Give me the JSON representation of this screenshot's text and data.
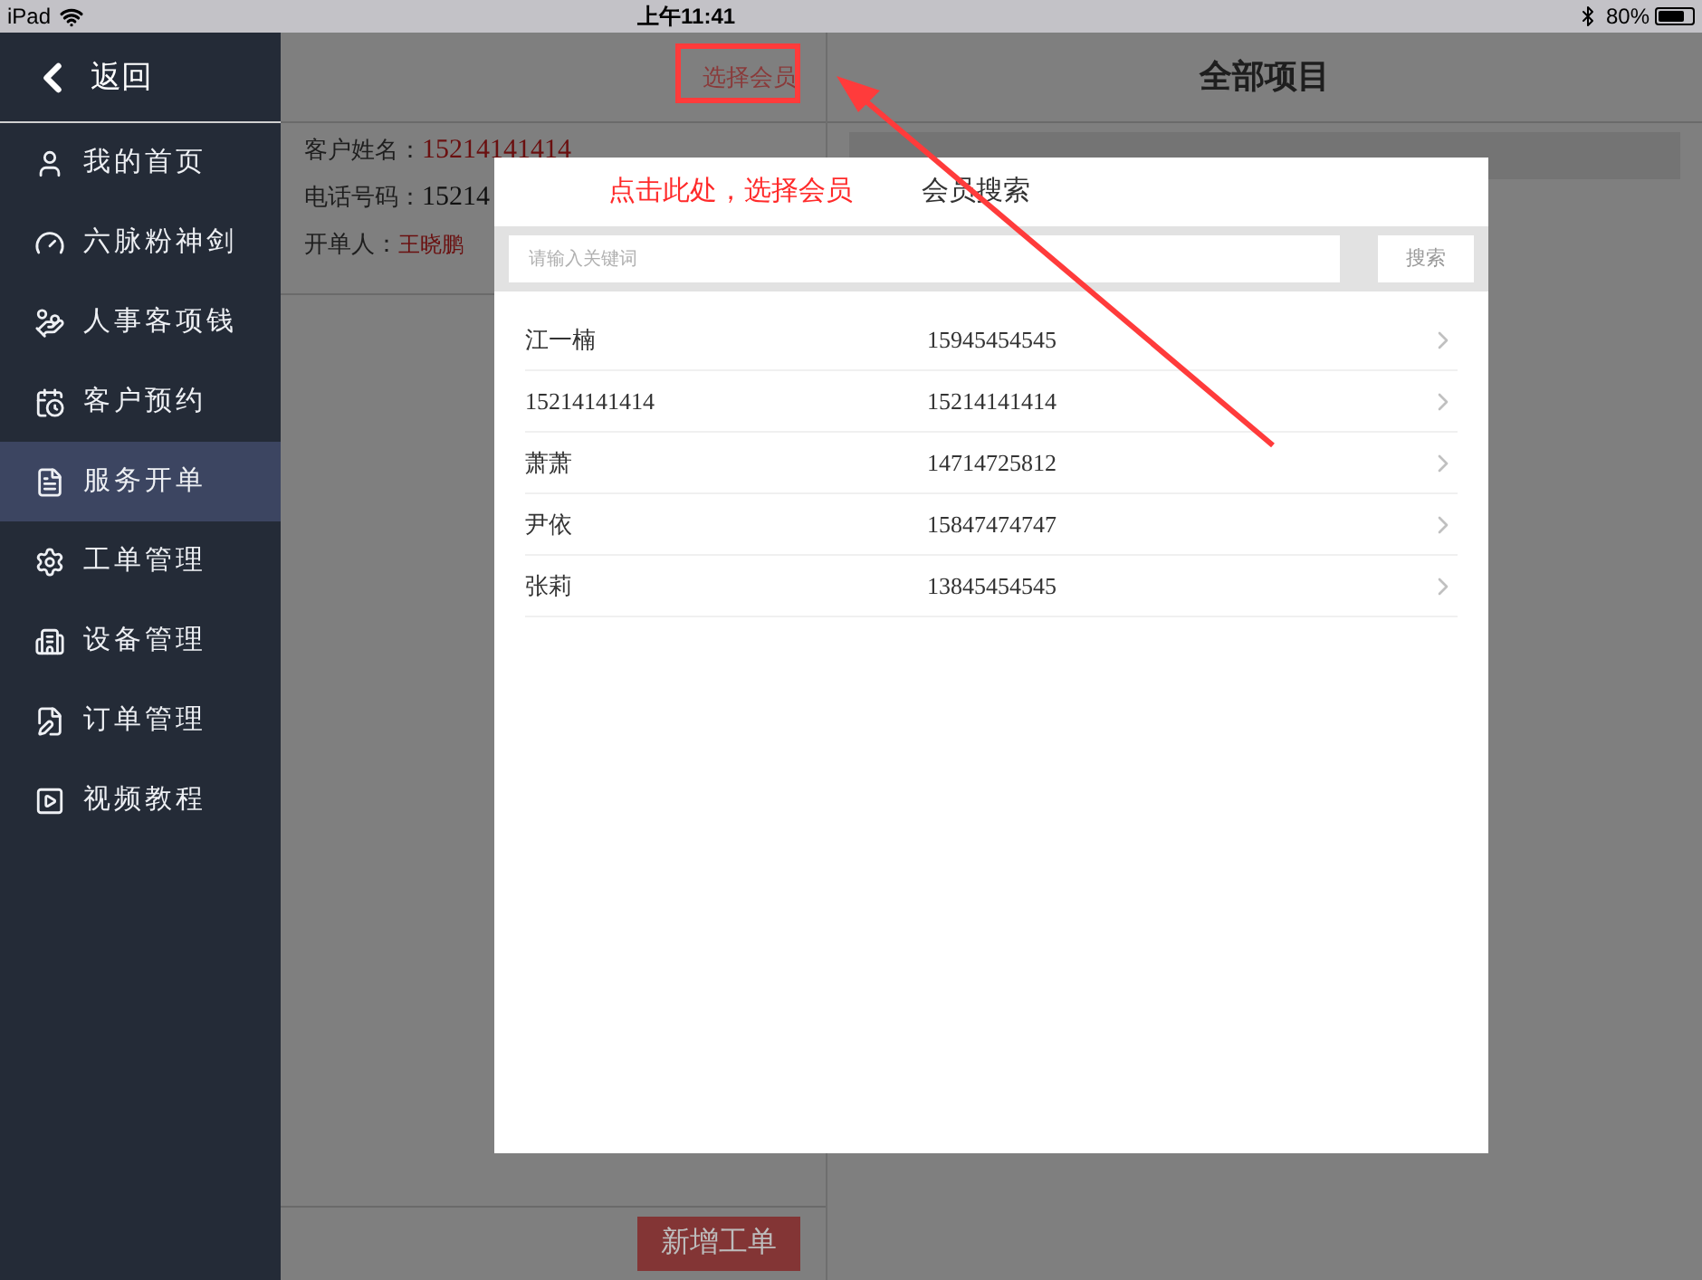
{
  "status_bar": {
    "device": "iPad",
    "time": "上午11:41",
    "battery": "80%"
  },
  "sidebar": {
    "back": "返回",
    "items": [
      {
        "label": "我的首页",
        "selected": false
      },
      {
        "label": "六脉粉神剑",
        "selected": false
      },
      {
        "label": "人事客项钱",
        "selected": false
      },
      {
        "label": "客户预约",
        "selected": false
      },
      {
        "label": "服务开单",
        "selected": true
      },
      {
        "label": "工单管理",
        "selected": false
      },
      {
        "label": "设备管理",
        "selected": false
      },
      {
        "label": "订单管理",
        "selected": false
      },
      {
        "label": "视频教程",
        "selected": false
      }
    ]
  },
  "order_panel": {
    "select_member": "选择会员",
    "fields": [
      {
        "label": "客户姓名：",
        "value": "15214141414",
        "kind": "name"
      },
      {
        "label": "电话号码：",
        "value": "15214",
        "kind": "phone"
      },
      {
        "label": "开单人：",
        "value": "王晓鹏",
        "kind": "opener"
      }
    ],
    "add_button": "新增工单"
  },
  "projects_panel": {
    "title": "全部项目"
  },
  "member_dialog": {
    "title": "会员搜索",
    "search": {
      "placeholder": "请输入关键词",
      "button": "搜索"
    },
    "members": [
      {
        "name": "江一楠",
        "phone": "15945454545"
      },
      {
        "name": "15214141414",
        "phone": "15214141414"
      },
      {
        "name": "萧萧",
        "phone": "14714725812"
      },
      {
        "name": "尹依",
        "phone": "15847474747"
      },
      {
        "name": "张莉",
        "phone": "13845454545"
      }
    ]
  },
  "annotation": {
    "text": "点击此处，选择会员"
  }
}
